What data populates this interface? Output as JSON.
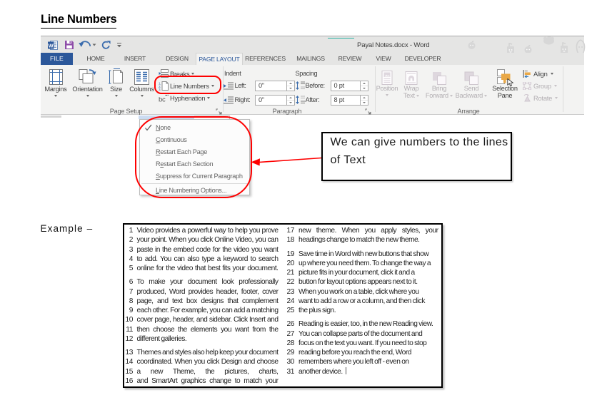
{
  "page": {
    "title": "Line Numbers",
    "example_label": "Example –"
  },
  "colors": {
    "file_tab_blue": "#2b579a",
    "annotation_red": "#fe0000",
    "selection_orange": "#eaa948",
    "save_icon_purple": "#8e4ca8",
    "teal_artifact": "#28b2a2",
    "titlebar_gray": "#e5e5e4",
    "ribbon_gray": "#f3f3f2"
  },
  "window": {
    "title": "Payal Notes.docx - Word",
    "tabs": [
      {
        "label": "FILE",
        "type": "file"
      },
      {
        "label": "HOME",
        "type": "normal"
      },
      {
        "label": "INSERT",
        "type": "normal"
      },
      {
        "label": "DESIGN",
        "type": "normal"
      },
      {
        "label": "PAGE LAYOUT",
        "type": "active"
      },
      {
        "label": "REFERENCES",
        "type": "normal"
      },
      {
        "label": "MAILINGS",
        "type": "normal"
      },
      {
        "label": "REVIEW",
        "type": "normal"
      },
      {
        "label": "VIEW",
        "type": "normal"
      },
      {
        "label": "DEVELOPER",
        "type": "normal"
      }
    ],
    "ribbon": {
      "page_setup": {
        "label": "Page Setup",
        "big_buttons": [
          {
            "label": "Margins",
            "icon": "margins"
          },
          {
            "label": "Orientation",
            "icon": "orientation"
          },
          {
            "label": "Size",
            "icon": "size"
          },
          {
            "label": "Columns",
            "icon": "columns"
          }
        ],
        "small_buttons": [
          {
            "label": "Breaks",
            "icon": "breaks"
          },
          {
            "label": "Line Numbers",
            "icon": "linenumbers"
          },
          {
            "label": "Hyphenation",
            "icon": "hyphenation"
          }
        ]
      },
      "paragraph": {
        "label": "Paragraph",
        "indent_label": "Indent",
        "spacing_label": "Spacing",
        "fields": [
          {
            "label": "Left:",
            "value": "0\"",
            "icon": "indent-left"
          },
          {
            "label": "Right:",
            "value": "0\"",
            "icon": "indent-right"
          },
          {
            "label": "Before:",
            "value": "0 pt",
            "icon": "spacing-before"
          },
          {
            "label": "After:",
            "value": "8 pt",
            "icon": "spacing-after"
          }
        ]
      },
      "arrange": {
        "label": "Arrange",
        "big_buttons": [
          {
            "label1": "Position",
            "label2": "",
            "icon": "position",
            "disabled": true
          },
          {
            "label1": "Wrap",
            "label2": "Text",
            "icon": "wraptext",
            "disabled": true
          },
          {
            "label1": "Bring",
            "label2": "Forward",
            "icon": "bringforward",
            "disabled": true
          },
          {
            "label1": "Send",
            "label2": "Backward",
            "icon": "sendbackward",
            "disabled": true
          },
          {
            "label1": "Selection",
            "label2": "Pane",
            "icon": "selectionpane",
            "disabled": false
          }
        ],
        "side_buttons": [
          {
            "label": "Align",
            "icon": "align",
            "disabled": false
          },
          {
            "label": "Group",
            "icon": "group",
            "disabled": true
          },
          {
            "label": "Rotate",
            "icon": "rotate",
            "disabled": true
          }
        ]
      }
    }
  },
  "menu": {
    "items": [
      {
        "label": "None",
        "accel": 0,
        "checked": true
      },
      {
        "label": "Continuous",
        "accel": 0
      },
      {
        "label": "Restart Each Page",
        "accel": 0
      },
      {
        "label": "Restart Each Section",
        "accel": 1
      },
      {
        "label": "Suppress for Current Paragraph",
        "accel": 0
      },
      {
        "label": "Line Numbering Options...",
        "accel": 0,
        "separator_before": true
      }
    ]
  },
  "callout": {
    "line1": "We can give numbers to the lines",
    "line2": "of Text"
  },
  "example": {
    "columns": [
      {
        "lines": [
          {
            "n": "1",
            "text": "Video provides a powerful way to help you prove",
            "j": true
          },
          {
            "n": "2",
            "text": "your point. When you click Online Video, you can",
            "j": true
          },
          {
            "n": "3",
            "text": "paste in the embed code for the video you want",
            "j": true
          },
          {
            "n": "4",
            "text": "to add. You can also type a keyword to search",
            "j": true
          },
          {
            "n": "5",
            "text": "online for the video that best fits your document.",
            "j": true
          },
          {
            "n": "6",
            "text": "To make your document look professionally",
            "j": true,
            "gap": true
          },
          {
            "n": "7",
            "text": "produced, Word provides header, footer, cover",
            "j": true
          },
          {
            "n": "8",
            "text": "page, and text box designs that complement",
            "j": true
          },
          {
            "n": "9",
            "text": "each other. For example, you can add a matching",
            "j": true
          },
          {
            "n": "10",
            "text": "cover page, header, and sidebar. Click Insert and",
            "j": true
          },
          {
            "n": "11",
            "text": "then choose the elements you want from the",
            "j": true
          },
          {
            "n": "12",
            "text": "different galleries.",
            "j": false
          },
          {
            "n": "13",
            "text": "Themes and styles also help keep your document",
            "j": true,
            "gap": true
          },
          {
            "n": "14",
            "text": "coordinated. When you click Design and choose",
            "j": true
          },
          {
            "n": "15",
            "text": "a new Theme, the pictures, charts,",
            "j": true
          },
          {
            "n": "16",
            "text": "and SmartArt graphics change to match your",
            "j": true
          }
        ]
      },
      {
        "lines": [
          {
            "n": "17",
            "text": "new theme. When you apply styles, your",
            "j": true
          },
          {
            "n": "18",
            "text": "headings change to match the new theme.",
            "j": false
          },
          {
            "n": "19",
            "text": "Save time in Word with new buttons that show",
            "j": false,
            "gap": true
          },
          {
            "n": "20",
            "text": "up where you need them. To change the way a",
            "j": false
          },
          {
            "n": "21",
            "text": "picture fits in your document, click it and a",
            "j": false
          },
          {
            "n": "22",
            "text": "button for layout options appears next to it.",
            "j": false
          },
          {
            "n": "23",
            "text": "When you work on a table, click where you",
            "j": false
          },
          {
            "n": "24",
            "text": "want to add a row or a column, and then click",
            "j": false
          },
          {
            "n": "25",
            "text": "the plus sign.",
            "j": false
          },
          {
            "n": "26",
            "text": "Reading is easier, too, in the new Reading view.",
            "j": false,
            "gap": true
          },
          {
            "n": "27",
            "text": "You can collapse parts of the document and",
            "j": false
          },
          {
            "n": "28",
            "text": "focus on the text you want. If you need to stop",
            "j": false
          },
          {
            "n": "29",
            "text": "reading before you reach the end, Word",
            "j": false
          },
          {
            "n": "30",
            "text": "remembers where you left off - even on",
            "j": false
          },
          {
            "n": "31",
            "text": "another device. ",
            "j": false,
            "cursor": true
          }
        ]
      }
    ]
  }
}
